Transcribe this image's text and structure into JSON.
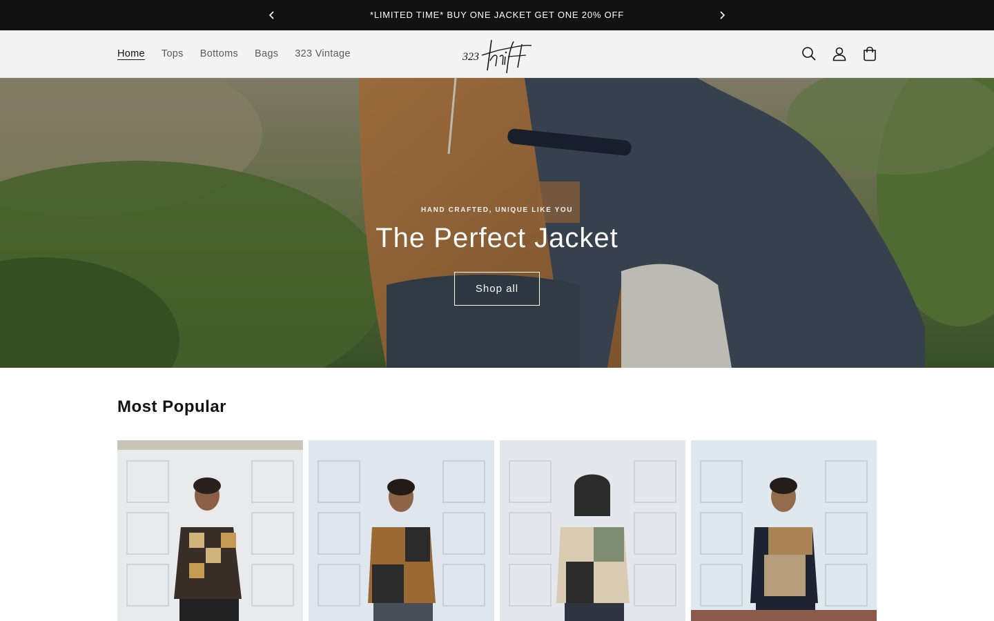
{
  "announcement": {
    "text": "*LIMITED TIME* BUY ONE JACKET GET ONE 20% OFF",
    "prev_icon": "chevron-left-icon",
    "next_icon": "chevron-right-icon"
  },
  "header": {
    "nav": [
      {
        "label": "Home",
        "active": true
      },
      {
        "label": "Tops",
        "active": false
      },
      {
        "label": "Bottoms",
        "active": false
      },
      {
        "label": "Bags",
        "active": false
      },
      {
        "label": "323 Vintage",
        "active": false
      }
    ],
    "logo_text": "323 thrift",
    "icons": [
      "search-icon",
      "account-icon",
      "cart-icon"
    ]
  },
  "hero": {
    "subheading": "HAND CRAFTED, UNIQUE LIKE YOU",
    "heading": "The Perfect Jacket",
    "button_label": "Shop all"
  },
  "collection": {
    "title": "Most Popular",
    "products": [
      {
        "image": "patchwork-jacket-brown-checker"
      },
      {
        "image": "patchwork-jacket-black-tan"
      },
      {
        "image": "patchwork-jacket-hooded-green"
      },
      {
        "image": "patchwork-jacket-navy-tan"
      }
    ]
  },
  "colors": {
    "announcement_bg": "#121212",
    "header_bg": "#f3f3f3",
    "text": "#121212"
  }
}
